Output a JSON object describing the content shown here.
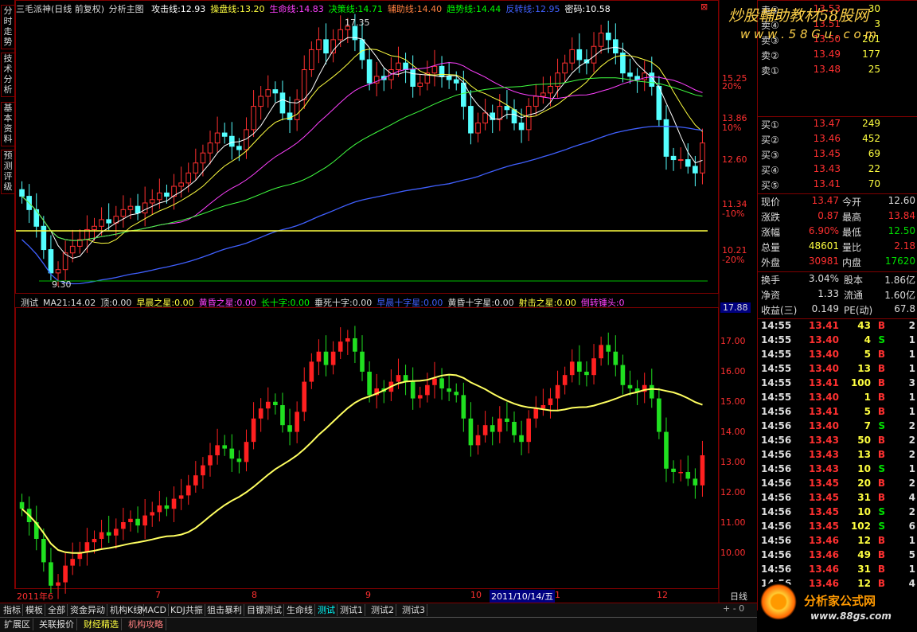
{
  "title": "三毛派神(日线 前复权)",
  "chart_title": "分析主图",
  "indicators_top": [
    {
      "label": "攻击线",
      "value": "12.93",
      "color": "#ffffff"
    },
    {
      "label": "操盘线",
      "value": "13.20",
      "color": "#ffff40"
    },
    {
      "label": "生命线",
      "value": "14.83",
      "color": "#ff40ff"
    },
    {
      "label": "决策线",
      "value": "14.71",
      "color": "#00ff00"
    },
    {
      "label": "辅助线",
      "value": "14.40",
      "color": "#ff8040"
    },
    {
      "label": "趋势线",
      "value": "14.44",
      "color": "#00ff00"
    },
    {
      "label": "反转线",
      "value": "12.95",
      "color": "#4060ff"
    },
    {
      "label": "密码",
      "value": "10.58",
      "color": "#ffffff"
    }
  ],
  "sub_indicators": [
    {
      "label": "测试",
      "value": "",
      "color": "#ddd"
    },
    {
      "label": "MA21",
      "value": "14.02",
      "color": "#ddd"
    },
    {
      "label": "顶",
      "value": "0.00",
      "color": "#ddd"
    },
    {
      "label": "早晨之星",
      "value": "0.00",
      "color": "#ffff40"
    },
    {
      "label": "黄昏之星",
      "value": "0.00",
      "color": "#ff40ff"
    },
    {
      "label": "长十字",
      "value": "0.00",
      "color": "#00ff00"
    },
    {
      "label": "垂死十字",
      "value": "0.00",
      "color": "#ddd"
    },
    {
      "label": "早晨十字星",
      "value": "0.00",
      "color": "#4060ff"
    },
    {
      "label": "黄昏十字星",
      "value": "0.00",
      "color": "#ddd"
    },
    {
      "label": "射击之星",
      "value": "0.00",
      "color": "#ffff40"
    },
    {
      "label": "倒转锤头",
      "value": "0",
      "color": "#ff40ff"
    }
  ],
  "top_axis": [
    "15.25",
    "20%",
    "13.86",
    "10%",
    "12.60",
    "11.34",
    "-10%",
    "10.21",
    "-20%"
  ],
  "sub_axis": [
    "17.88",
    "17.00",
    "16.00",
    "15.00",
    "14.00",
    "13.00",
    "12.00",
    "11.00",
    "10.00"
  ],
  "annotations": {
    "high": "17.35",
    "low": "9.30"
  },
  "date_axis": [
    "2011年6",
    "7",
    "8",
    "9",
    "10",
    "2011/10/14/五",
    "1",
    "12"
  ],
  "order_book": {
    "sells": [
      {
        "label": "卖⑤",
        "price": "13.53",
        "vol": "30"
      },
      {
        "label": "卖④",
        "price": "13.51",
        "vol": "3"
      },
      {
        "label": "卖③",
        "price": "13.50",
        "vol": "201"
      },
      {
        "label": "卖②",
        "price": "13.49",
        "vol": "177"
      },
      {
        "label": "卖①",
        "price": "13.48",
        "vol": "25"
      }
    ],
    "buys": [
      {
        "label": "买①",
        "price": "13.47",
        "vol": "249"
      },
      {
        "label": "买②",
        "price": "13.46",
        "vol": "452"
      },
      {
        "label": "买③",
        "price": "13.45",
        "vol": "69"
      },
      {
        "label": "买④",
        "price": "13.43",
        "vol": "22"
      },
      {
        "label": "买⑤",
        "price": "13.41",
        "vol": "70"
      }
    ]
  },
  "quote": [
    {
      "l1": "现价",
      "v1": "13.47",
      "c1": "red",
      "l2": "今开",
      "v2": "12.60",
      "c2": "white"
    },
    {
      "l1": "涨跌",
      "v1": "0.87",
      "c1": "red",
      "l2": "最高",
      "v2": "13.84",
      "c2": "red"
    },
    {
      "l1": "涨幅",
      "v1": "6.90%",
      "c1": "red",
      "l2": "最低",
      "v2": "12.50",
      "c2": "green"
    },
    {
      "l1": "总量",
      "v1": "48601",
      "c1": "yellow",
      "l2": "量比",
      "v2": "2.18",
      "c2": "red"
    },
    {
      "l1": "外盘",
      "v1": "30981",
      "c1": "red",
      "l2": "内盘",
      "v2": "17620",
      "c2": "green"
    }
  ],
  "finance": [
    {
      "l1": "换手",
      "v1": "3.04%",
      "l2": "股本",
      "v2": "1.86亿"
    },
    {
      "l1": "净资",
      "v1": "1.33",
      "l2": "流通",
      "v2": "1.60亿"
    },
    {
      "l1": "收益(三)",
      "v1": "0.149",
      "l2": "PE(动)",
      "v2": "67.8"
    }
  ],
  "ticks": [
    {
      "t": "14:55",
      "p": "13.41",
      "v": "43",
      "s": "B",
      "n": "2"
    },
    {
      "t": "14:55",
      "p": "13.40",
      "v": "4",
      "s": "S",
      "n": "1"
    },
    {
      "t": "14:55",
      "p": "13.40",
      "v": "5",
      "s": "B",
      "n": "1"
    },
    {
      "t": "14:55",
      "p": "13.40",
      "v": "13",
      "s": "B",
      "n": "1"
    },
    {
      "t": "14:55",
      "p": "13.41",
      "v": "100",
      "s": "B",
      "n": "3"
    },
    {
      "t": "14:55",
      "p": "13.40",
      "v": "1",
      "s": "B",
      "n": "1"
    },
    {
      "t": "14:56",
      "p": "13.41",
      "v": "5",
      "s": "B",
      "n": "1"
    },
    {
      "t": "14:56",
      "p": "13.40",
      "v": "7",
      "s": "S",
      "n": "2"
    },
    {
      "t": "14:56",
      "p": "13.43",
      "v": "50",
      "s": "B",
      "n": "2"
    },
    {
      "t": "14:56",
      "p": "13.43",
      "v": "13",
      "s": "B",
      "n": "2"
    },
    {
      "t": "14:56",
      "p": "13.43",
      "v": "10",
      "s": "S",
      "n": "1"
    },
    {
      "t": "14:56",
      "p": "13.45",
      "v": "20",
      "s": "B",
      "n": "2"
    },
    {
      "t": "14:56",
      "p": "13.45",
      "v": "31",
      "s": "B",
      "n": "4"
    },
    {
      "t": "14:56",
      "p": "13.45",
      "v": "10",
      "s": "S",
      "n": "2"
    },
    {
      "t": "14:56",
      "p": "13.45",
      "v": "102",
      "s": "S",
      "n": "6"
    },
    {
      "t": "14:56",
      "p": "13.46",
      "v": "12",
      "s": "B",
      "n": "1"
    },
    {
      "t": "14:56",
      "p": "13.46",
      "v": "49",
      "s": "B",
      "n": "5"
    },
    {
      "t": "14:56",
      "p": "13.46",
      "v": "31",
      "s": "B",
      "n": "1"
    },
    {
      "t": "14:56",
      "p": "13.46",
      "v": "12",
      "s": "B",
      "n": "4"
    }
  ],
  "side_tabs": [
    "分时走势",
    "技术分析",
    "基本资料",
    "预测评级"
  ],
  "bottom_tabs": [
    "指标",
    "模板",
    "全部",
    "资金异动",
    "机构K线",
    "MACD",
    "KDJ共振",
    "狙击暴利",
    "目镖测试",
    "生命线",
    "测试",
    "测试1",
    "测试2",
    "测试3"
  ],
  "bottom_tabs2": [
    "扩展区",
    "关联报价",
    "财经精选",
    "机构攻略"
  ],
  "period_label": "日线",
  "watermark": {
    "top": "炒股輔助教材58股网",
    "url": "w w w . 5 8 G u . c o m",
    "bot": "分析家公式网",
    "bot2": "www.88gs.com"
  },
  "chart_data": {
    "type": "candlestick",
    "ylim_main": [
      9.0,
      17.6
    ],
    "ylim_sub": [
      9.5,
      17.88
    ],
    "closes": [
      11.9,
      11.5,
      11.0,
      10.3,
      9.6,
      9.7,
      10.2,
      10.4,
      10.6,
      10.9,
      11.0,
      11.2,
      11.1,
      11.3,
      11.5,
      11.6,
      11.4,
      11.7,
      11.8,
      12.0,
      11.9,
      12.2,
      12.3,
      12.6,
      12.9,
      13.2,
      13.5,
      13.8,
      13.7,
      13.4,
      13.3,
      13.9,
      14.6,
      14.9,
      15.1,
      15.0,
      14.4,
      14.2,
      14.8,
      15.7,
      16.3,
      16.6,
      16.2,
      16.6,
      16.9,
      17.0,
      16.6,
      16.0,
      15.3,
      15.5,
      15.4,
      15.7,
      15.9,
      15.7,
      15.2,
      15.3,
      15.6,
      15.8,
      15.5,
      15.4,
      15.3,
      14.6,
      13.8,
      14.1,
      14.4,
      14.2,
      14.6,
      14.5,
      14.1,
      13.9,
      14.6,
      14.9,
      15.0,
      15.2,
      15.6,
      15.9,
      16.3,
      16.0,
      15.9,
      16.4,
      16.8,
      16.6,
      16.2,
      15.6,
      15.5,
      15.4,
      15.6,
      15.2,
      14.2,
      13.1,
      13.0,
      13.0,
      12.8,
      12.6,
      13.5
    ]
  }
}
